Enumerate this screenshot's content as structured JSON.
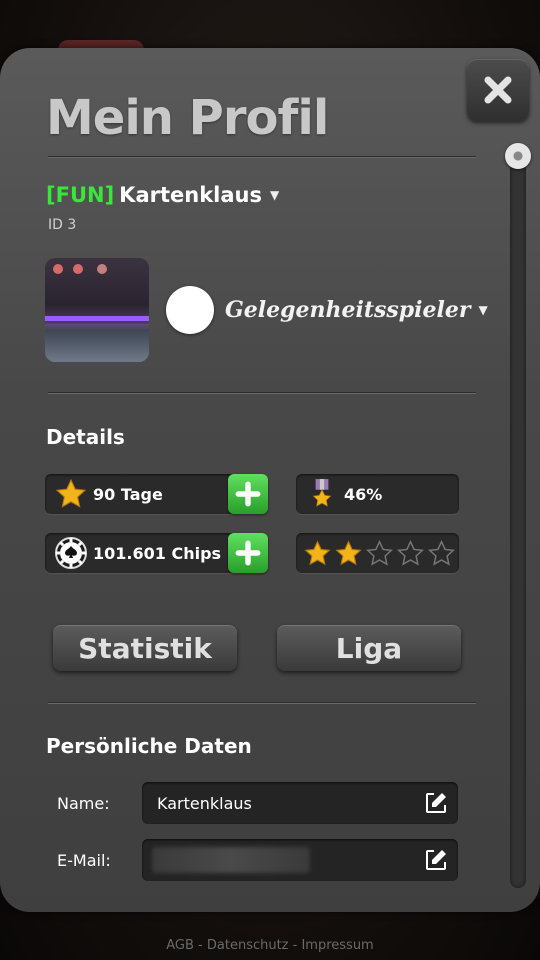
{
  "title": "Mein Profil",
  "user": {
    "tag": "[FUN]",
    "name": "Kartenklaus",
    "id": "ID 3"
  },
  "level": {
    "name": "Gelegenheitsspieler"
  },
  "details": {
    "heading": "Details",
    "days": "90 Tage",
    "percent": "46%",
    "chips": "101.601 Chips",
    "stars_filled": 2,
    "stars_total": 5
  },
  "buttons": {
    "statistik": "Statistik",
    "liga": "Liga"
  },
  "personal": {
    "heading": "Persönliche Daten",
    "name_label": "Name:",
    "name_value": "Kartenklaus",
    "email_label": "E-Mail:"
  },
  "footer": {
    "text": "AGB - Datenschutz - Impressum"
  },
  "colors": {
    "tag": "#39e639",
    "plus": "#3cc83c",
    "star": "#f3b41b"
  },
  "icons": [
    "close-icon",
    "star-icon",
    "medal-icon",
    "chip-icon",
    "plus-icon",
    "edit-icon",
    "caret-down-icon"
  ]
}
